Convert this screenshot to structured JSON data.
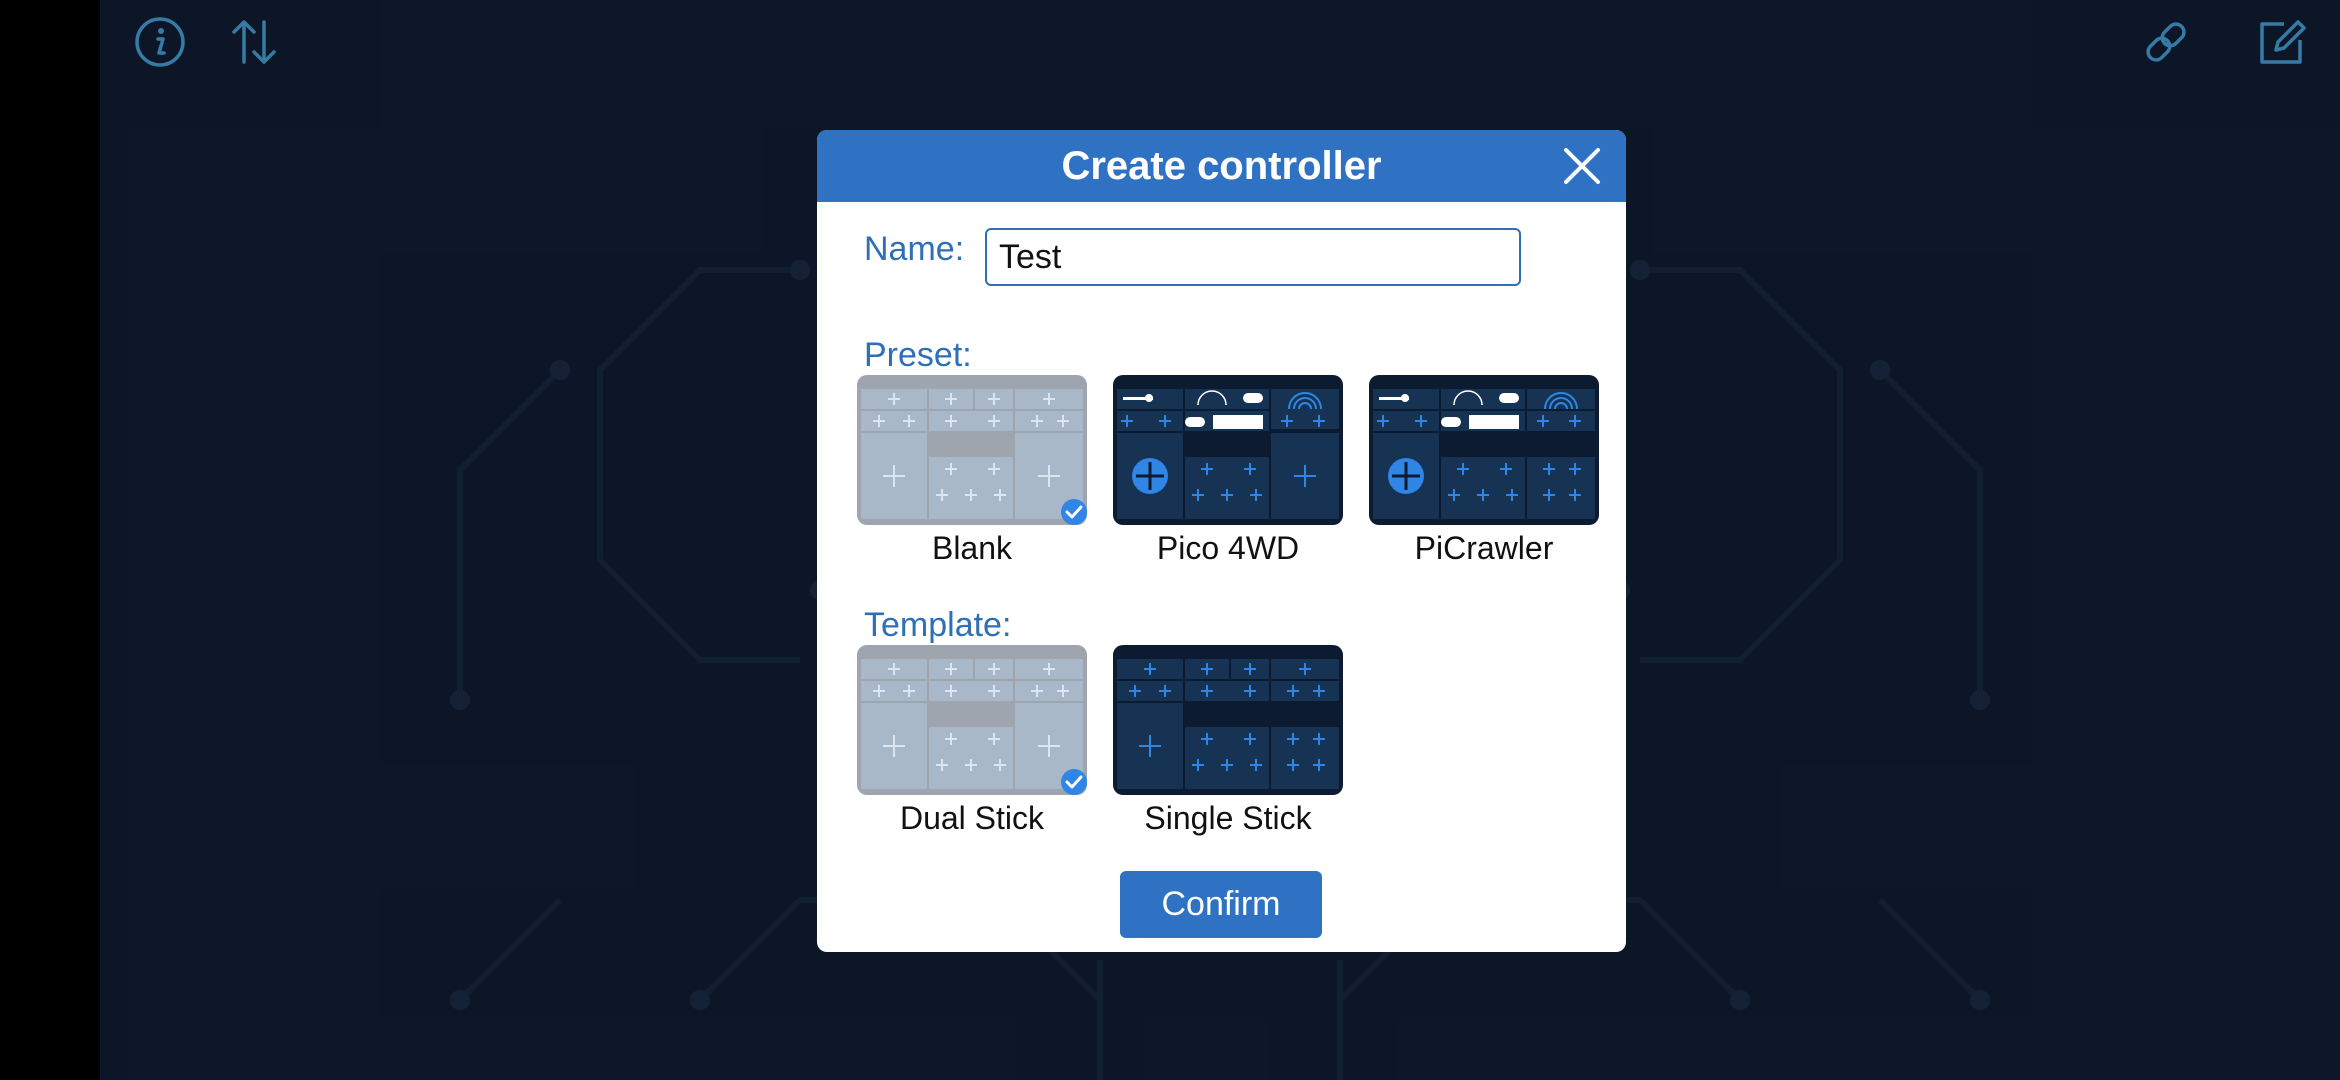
{
  "toolbar": {
    "left_icons": [
      "info-icon",
      "sort-arrows-icon"
    ],
    "right_icons": [
      "link-icon",
      "edit-icon"
    ]
  },
  "dialog": {
    "title": "Create controller",
    "name_label": "Name:",
    "name_value": "Test",
    "preset_label": "Preset:",
    "template_label": "Template:",
    "presets": [
      {
        "label": "Blank",
        "selected": true
      },
      {
        "label": "Pico 4WD",
        "selected": false
      },
      {
        "label": "PiCrawler",
        "selected": false
      }
    ],
    "templates": [
      {
        "label": "Dual Stick",
        "selected": true
      },
      {
        "label": "Single Stick",
        "selected": false
      }
    ],
    "confirm_label": "Confirm"
  },
  "colors": {
    "background": "#0f1a2c",
    "accent": "#2f72c4",
    "icon": "#4fb3f0",
    "label": "#2f6fb8"
  }
}
